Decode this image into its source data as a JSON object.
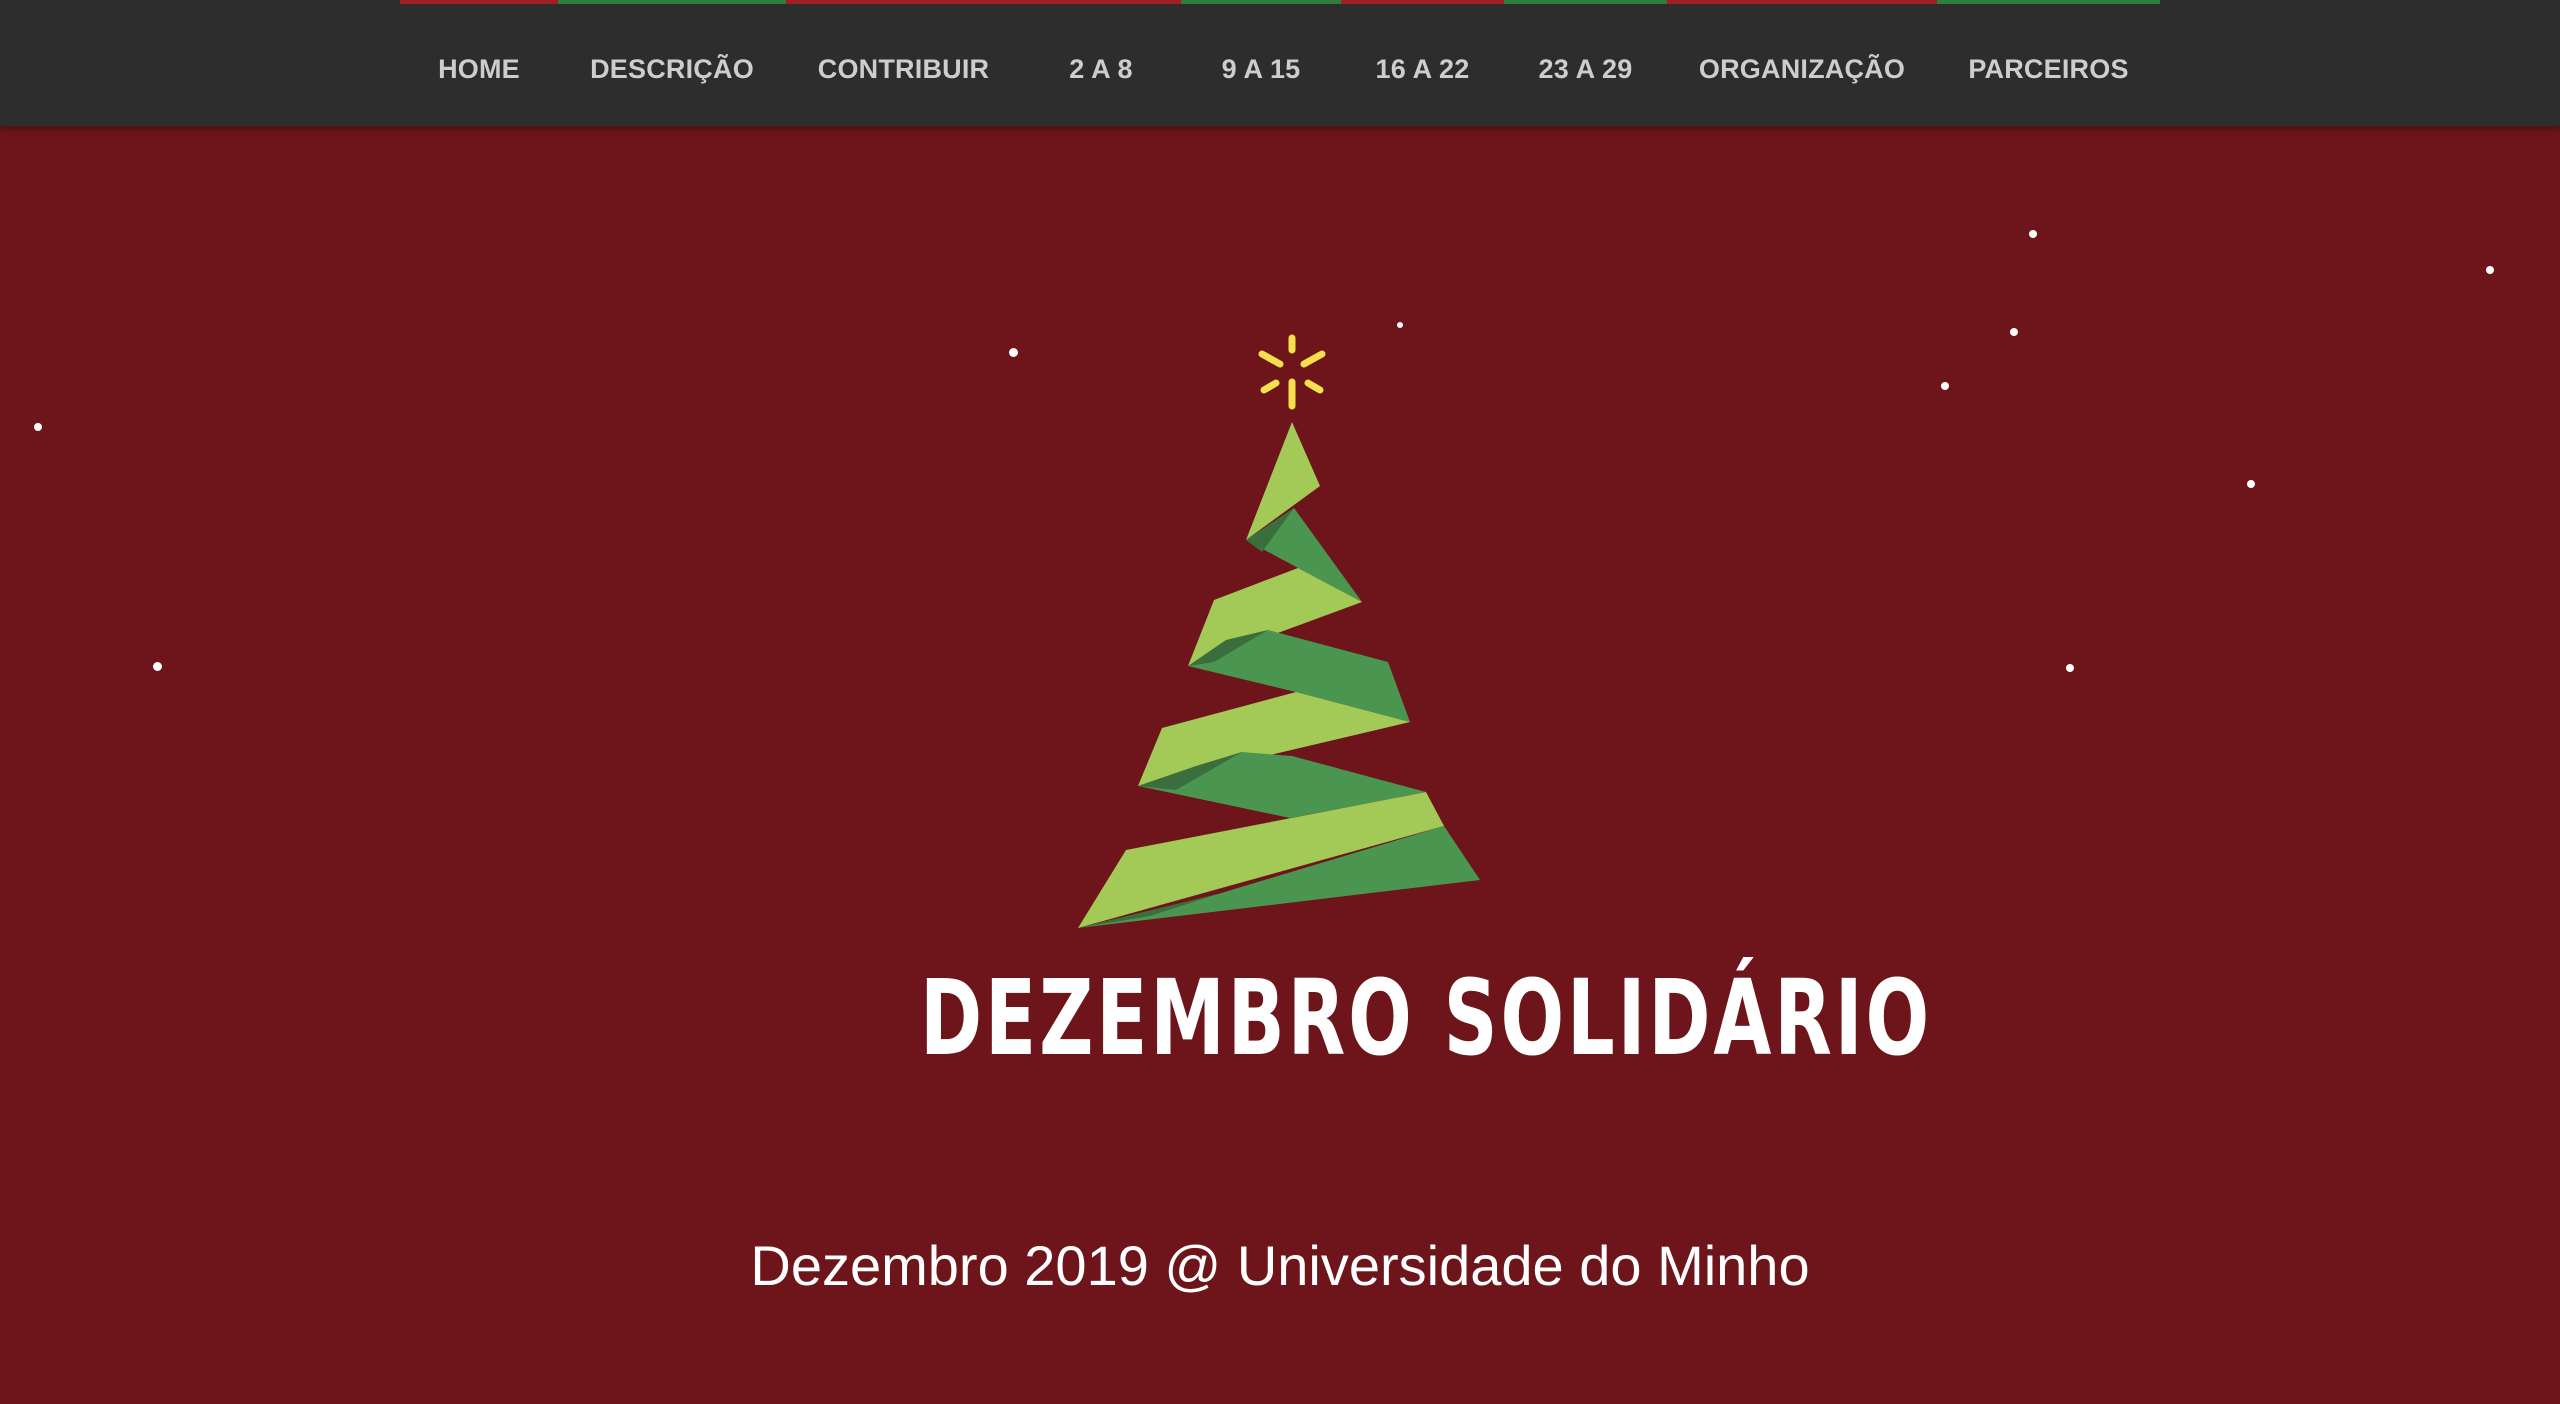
{
  "nav": {
    "items": [
      {
        "label": "HOME",
        "accent": "#a01f24"
      },
      {
        "label": "DESCRIÇÃO",
        "accent": "#2e7d3a"
      },
      {
        "label": "CONTRIBUIR",
        "accent": "#a01f24"
      },
      {
        "label": "2 A 8",
        "accent": "#a01f24"
      },
      {
        "label": "9 A 15",
        "accent": "#2e7d3a"
      },
      {
        "label": "16 A 22",
        "accent": "#a01f24"
      },
      {
        "label": "23 A 29",
        "accent": "#2e7d3a"
      },
      {
        "label": "ORGANIZAÇÃO",
        "accent": "#a01f24"
      },
      {
        "label": "PARCEIROS",
        "accent": "#2e7d3a"
      }
    ]
  },
  "hero": {
    "logo_icon": "christmas-tree-icon",
    "star_icon": "star-icon",
    "title": "DEZEMBRO SOLIDÁRIO",
    "subtitle": "Dezembro 2019 @ Universidade do Minho"
  },
  "colors": {
    "background": "#6e151b",
    "navbar": "#2d2d2d",
    "nav_text": "#cdcdcd",
    "tree_light": "#a3c957",
    "tree_dark": "#4a9650",
    "tree_shadow": "#3a6e3c",
    "star": "#f4e04d",
    "text": "#ffffff"
  }
}
